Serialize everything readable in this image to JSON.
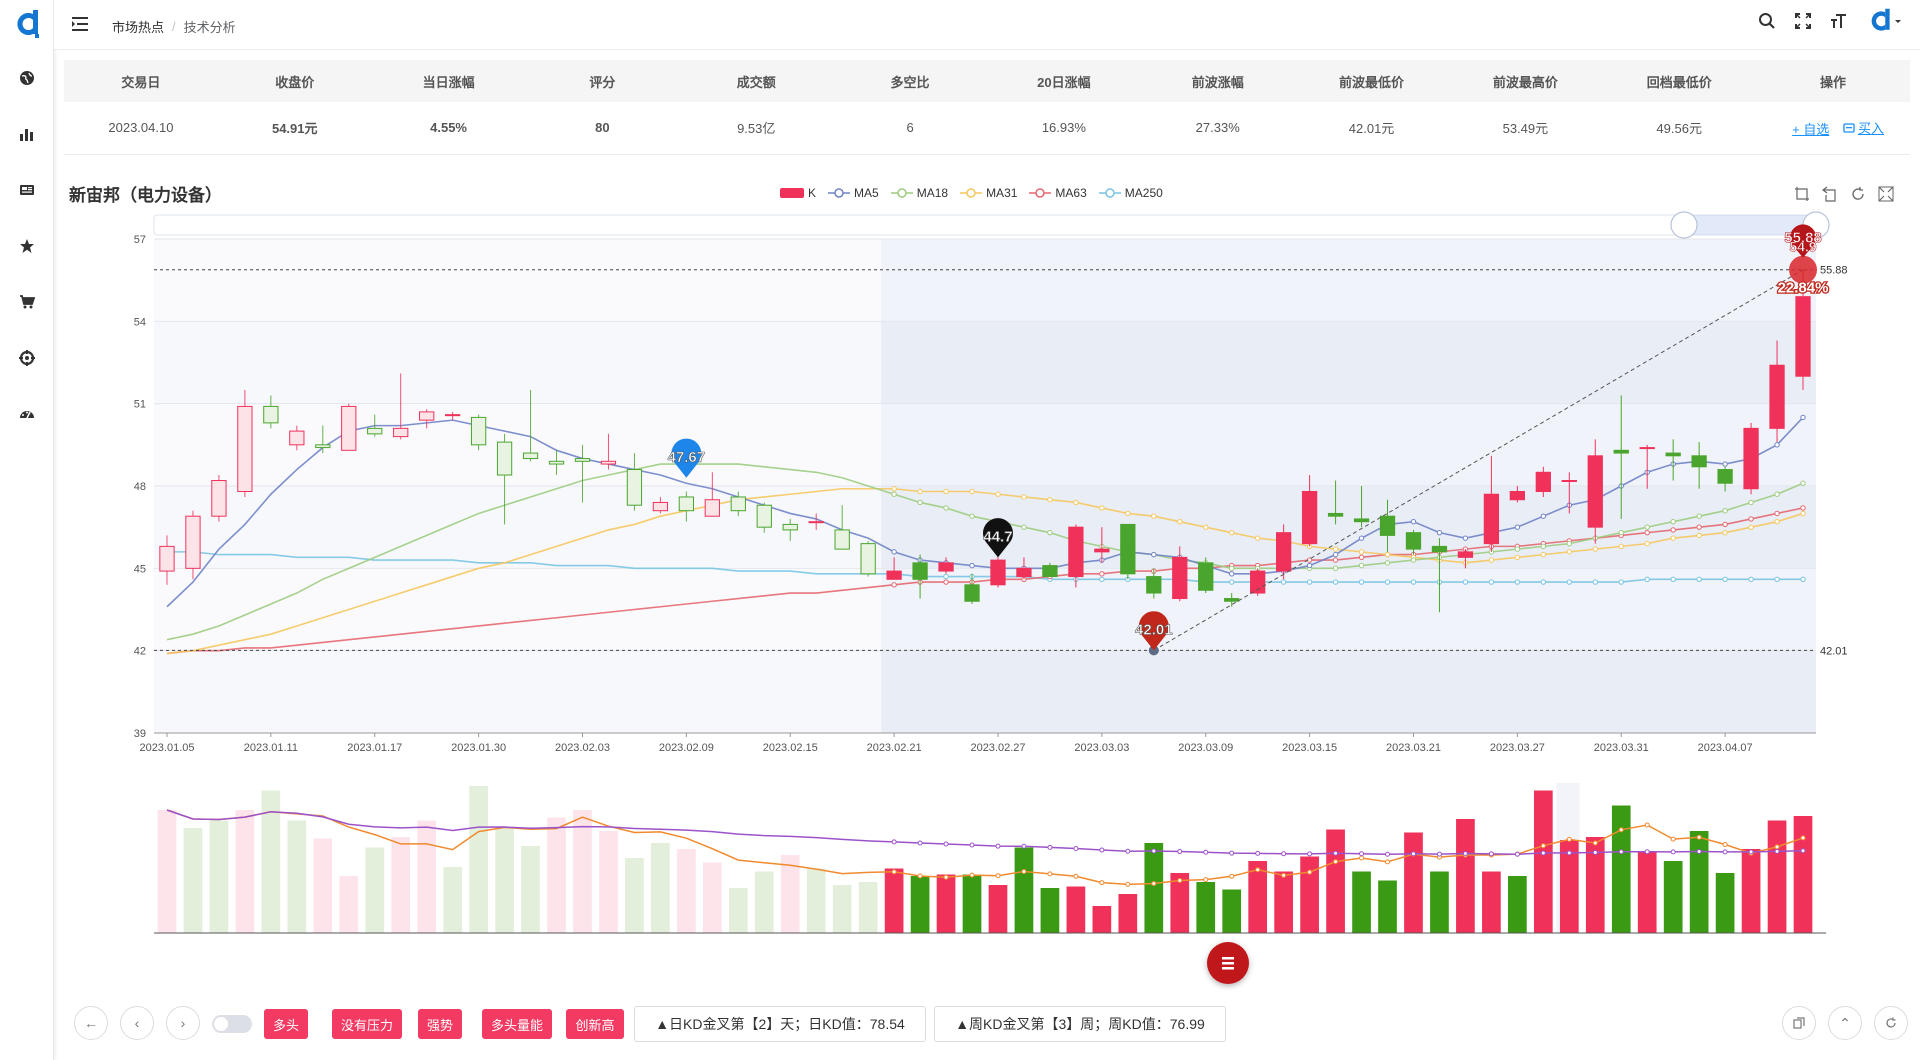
{
  "breadcrumb": {
    "parent": "市场热点",
    "current": "技术分析"
  },
  "summary": {
    "headers": [
      "交易日",
      "收盘价",
      "当日涨幅",
      "评分",
      "成交额",
      "多空比",
      "20日涨幅",
      "前波涨幅",
      "前波最低价",
      "前波最高价",
      "回档最低价",
      "操作"
    ],
    "row": {
      "trade_date": "2023.04.10",
      "close": "54.91元",
      "day_change": "4.55%",
      "score": "80",
      "turnover": "9.53亿",
      "bull_bear": "6",
      "change_20d": "16.93%",
      "prev_wave_change": "27.33%",
      "prev_wave_low": "42.01元",
      "prev_wave_high": "53.49元",
      "pullback_low": "49.56元",
      "op_watch": "+ 自选",
      "op_buy": "买入"
    }
  },
  "chart_title": "新宙邦（电力设备）",
  "legend": [
    {
      "name": "K",
      "color": "#f0325b"
    },
    {
      "name": "MA5",
      "color": "#6f83c6"
    },
    {
      "name": "MA18",
      "color": "#9ccc7f"
    },
    {
      "name": "MA31",
      "color": "#f5c75d"
    },
    {
      "name": "MA63",
      "color": "#e4676f"
    },
    {
      "name": "MA250",
      "color": "#79c4e2"
    }
  ],
  "chart_data": {
    "type": "candlestick",
    "x_ticks": [
      "2023.01.05",
      "2023.01.11",
      "2023.01.17",
      "2023.01.30",
      "2023.02.03",
      "2023.02.09",
      "2023.02.15",
      "2023.02.21",
      "2023.02.27",
      "2023.03.03",
      "2023.03.09",
      "2023.03.15",
      "2023.03.21",
      "2023.03.27",
      "2023.03.31",
      "2023.04.07"
    ],
    "y_ticks": [
      57,
      54,
      51,
      48,
      45,
      42,
      39
    ],
    "ylim": [
      39,
      57
    ],
    "ohlc": [
      [
        44.9,
        45.8,
        44.4,
        46.2
      ],
      [
        45.0,
        46.9,
        44.6,
        47.1
      ],
      [
        46.9,
        48.2,
        46.7,
        48.4
      ],
      [
        47.8,
        50.9,
        47.6,
        51.5
      ],
      [
        50.9,
        50.3,
        50.1,
        51.3
      ],
      [
        49.5,
        50.0,
        49.3,
        50.2
      ],
      [
        49.5,
        49.4,
        49.2,
        50.2
      ],
      [
        49.3,
        50.9,
        49.3,
        51.0
      ],
      [
        50.1,
        49.9,
        49.8,
        50.6
      ],
      [
        49.8,
        50.1,
        49.7,
        52.1
      ],
      [
        50.4,
        50.7,
        50.1,
        50.8
      ],
      [
        50.6,
        50.6,
        50.4,
        50.7
      ],
      [
        50.5,
        49.5,
        49.3,
        50.6
      ],
      [
        49.6,
        48.4,
        46.6,
        49.9
      ],
      [
        49.2,
        49.0,
        48.9,
        51.5
      ],
      [
        48.9,
        48.8,
        48.4,
        49.3
      ],
      [
        49.0,
        48.9,
        47.4,
        49.5
      ],
      [
        48.8,
        48.9,
        48.6,
        49.9
      ],
      [
        48.6,
        47.3,
        47.1,
        49.2
      ],
      [
        47.1,
        47.4,
        47.0,
        47.6
      ],
      [
        47.6,
        47.1,
        46.7,
        47.8
      ],
      [
        46.9,
        47.5,
        46.9,
        48.5
      ],
      [
        47.6,
        47.1,
        46.9,
        47.8
      ],
      [
        47.3,
        46.5,
        46.3,
        47.4
      ],
      [
        46.6,
        46.4,
        46.0,
        46.8
      ],
      [
        46.7,
        46.7,
        46.4,
        47.0
      ],
      [
        46.4,
        45.7,
        45.7,
        47.3
      ],
      [
        45.9,
        44.8,
        44.7,
        46.0
      ],
      [
        44.6,
        44.9,
        44.6,
        45.4
      ],
      [
        45.2,
        44.6,
        43.9,
        45.5
      ],
      [
        44.9,
        45.2,
        44.8,
        45.4
      ],
      [
        44.4,
        43.8,
        43.7,
        44.8
      ],
      [
        44.4,
        45.3,
        44.3,
        45.6
      ],
      [
        44.7,
        45.0,
        44.6,
        45.4
      ],
      [
        45.1,
        44.7,
        44.7,
        45.2
      ],
      [
        44.7,
        46.5,
        44.3,
        46.6
      ],
      [
        45.6,
        45.7,
        45.2,
        46.5
      ],
      [
        46.6,
        44.8,
        44.6,
        46.6
      ],
      [
        44.7,
        44.1,
        43.9,
        45.0
      ],
      [
        43.9,
        45.4,
        43.8,
        45.8
      ],
      [
        45.2,
        44.2,
        44.1,
        45.4
      ],
      [
        43.9,
        43.8,
        43.6,
        44.1
      ],
      [
        44.1,
        44.9,
        44.0,
        45.0
      ],
      [
        44.9,
        46.3,
        44.6,
        46.6
      ],
      [
        45.9,
        47.8,
        45.8,
        48.4
      ],
      [
        47.0,
        46.9,
        46.6,
        48.2
      ],
      [
        46.8,
        46.7,
        46.5,
        48.0
      ],
      [
        46.9,
        46.2,
        45.6,
        47.5
      ],
      [
        46.3,
        45.7,
        45.5,
        46.4
      ],
      [
        45.8,
        45.6,
        43.4,
        46.1
      ],
      [
        45.4,
        45.6,
        45.0,
        45.7
      ],
      [
        45.9,
        47.7,
        45.6,
        49.1
      ],
      [
        47.5,
        47.8,
        47.4,
        48.0
      ],
      [
        47.8,
        48.5,
        47.6,
        48.7
      ],
      [
        48.2,
        48.2,
        47.0,
        48.5
      ],
      [
        46.5,
        49.1,
        45.9,
        49.7
      ],
      [
        49.3,
        49.2,
        46.8,
        51.3
      ],
      [
        49.4,
        49.4,
        47.9,
        49.5
      ],
      [
        49.2,
        49.1,
        48.2,
        49.7
      ],
      [
        49.1,
        48.7,
        47.9,
        49.6
      ],
      [
        48.6,
        48.1,
        47.8,
        48.7
      ],
      [
        47.9,
        50.1,
        47.7,
        50.3
      ],
      [
        50.1,
        52.4,
        49.6,
        53.3
      ],
      [
        52.0,
        54.9,
        51.5,
        55.9
      ]
    ],
    "ma5": [
      43.6,
      44.5,
      45.7,
      46.6,
      47.7,
      48.6,
      49.4,
      50.0,
      50.2,
      50.2,
      50.3,
      50.4,
      50.2,
      50.0,
      49.8,
      49.3,
      49.0,
      48.8,
      48.6,
      48.4,
      48.1,
      47.9,
      47.6,
      47.3,
      47.0,
      46.8,
      46.4,
      46.1,
      45.6,
      45.3,
      45.2,
      45.1,
      45.0,
      45.0,
      45.0,
      45.2,
      45.3,
      45.6,
      45.5,
      45.4,
      45.1,
      44.8,
      44.8,
      44.9,
      45.1,
      45.5,
      46.1,
      46.6,
      46.7,
      46.3,
      46.1,
      46.3,
      46.5,
      46.9,
      47.3,
      47.5,
      48.0,
      48.5,
      48.8,
      48.9,
      48.8,
      49.0,
      49.5,
      50.5
    ],
    "ma18": [
      42.4,
      42.6,
      42.9,
      43.3,
      43.7,
      44.1,
      44.6,
      45.0,
      45.4,
      45.8,
      46.2,
      46.6,
      47.0,
      47.3,
      47.6,
      47.9,
      48.2,
      48.4,
      48.6,
      48.8,
      48.8,
      48.8,
      48.8,
      48.7,
      48.6,
      48.5,
      48.3,
      48.0,
      47.7,
      47.4,
      47.2,
      46.9,
      46.7,
      46.5,
      46.3,
      46.0,
      45.8,
      45.6,
      45.5,
      45.3,
      45.2,
      45.0,
      45.0,
      45.0,
      45.0,
      45.0,
      45.1,
      45.2,
      45.3,
      45.4,
      45.5,
      45.6,
      45.7,
      45.8,
      45.9,
      46.1,
      46.3,
      46.5,
      46.7,
      46.9,
      47.1,
      47.4,
      47.7,
      48.1
    ],
    "ma31": [
      41.9,
      42.0,
      42.2,
      42.4,
      42.6,
      42.9,
      43.2,
      43.5,
      43.8,
      44.1,
      44.4,
      44.7,
      45.0,
      45.2,
      45.5,
      45.8,
      46.1,
      46.4,
      46.6,
      46.9,
      47.1,
      47.3,
      47.5,
      47.6,
      47.7,
      47.8,
      47.9,
      47.9,
      47.9,
      47.8,
      47.8,
      47.8,
      47.7,
      47.6,
      47.5,
      47.4,
      47.2,
      47.0,
      46.9,
      46.7,
      46.5,
      46.3,
      46.1,
      46.0,
      45.8,
      45.7,
      45.6,
      45.5,
      45.4,
      45.3,
      45.2,
      45.3,
      45.4,
      45.5,
      45.6,
      45.7,
      45.8,
      45.9,
      46.1,
      46.2,
      46.3,
      46.5,
      46.7,
      47.0
    ],
    "ma63": [
      41.9,
      42.0,
      42.0,
      42.1,
      42.1,
      42.2,
      42.3,
      42.4,
      42.5,
      42.6,
      42.7,
      42.8,
      42.9,
      43.0,
      43.1,
      43.2,
      43.3,
      43.4,
      43.5,
      43.6,
      43.7,
      43.8,
      43.9,
      44.0,
      44.1,
      44.1,
      44.2,
      44.3,
      44.4,
      44.5,
      44.5,
      44.5,
      44.6,
      44.6,
      44.7,
      44.8,
      44.8,
      44.9,
      44.9,
      45.0,
      45.0,
      45.1,
      45.1,
      45.2,
      45.3,
      45.3,
      45.4,
      45.5,
      45.5,
      45.6,
      45.7,
      45.8,
      45.8,
      45.9,
      46.0,
      46.1,
      46.2,
      46.3,
      46.4,
      46.5,
      46.6,
      46.8,
      47.0,
      47.2
    ],
    "ma250": [
      45.6,
      45.6,
      45.5,
      45.5,
      45.5,
      45.4,
      45.4,
      45.4,
      45.3,
      45.3,
      45.3,
      45.3,
      45.2,
      45.2,
      45.2,
      45.1,
      45.1,
      45.1,
      45.0,
      45.0,
      45.0,
      45.0,
      44.9,
      44.9,
      44.9,
      44.8,
      44.8,
      44.8,
      44.8,
      44.7,
      44.7,
      44.7,
      44.7,
      44.7,
      44.6,
      44.6,
      44.6,
      44.6,
      44.6,
      44.6,
      44.5,
      44.5,
      44.5,
      44.5,
      44.5,
      44.5,
      44.5,
      44.5,
      44.5,
      44.5,
      44.5,
      44.5,
      44.5,
      44.5,
      44.5,
      44.5,
      44.5,
      44.6,
      44.6,
      44.6,
      44.6,
      44.6,
      44.6,
      44.6
    ],
    "volume": [
      82,
      70,
      75,
      82,
      95,
      75,
      63,
      38,
      57,
      64,
      75,
      44,
      98,
      71,
      58,
      77,
      82,
      68,
      50,
      60,
      56,
      47,
      30,
      41,
      52,
      43,
      32,
      34,
      43,
      38,
      39,
      39,
      32,
      57,
      30,
      31,
      18,
      26,
      60,
      40,
      34,
      29,
      48,
      41,
      51,
      69,
      41,
      35,
      67,
      41,
      76,
      41,
      38,
      95,
      62,
      64,
      85,
      54,
      48,
      68,
      40,
      56,
      75,
      78
    ],
    "volume_up": [
      true,
      false,
      false,
      true,
      false,
      false,
      true,
      true,
      false,
      true,
      true,
      false,
      false,
      false,
      false,
      true,
      true,
      true,
      false,
      false,
      true,
      true,
      false,
      false,
      true,
      false,
      false,
      false,
      true,
      false,
      true,
      false,
      true,
      false,
      false,
      true,
      true,
      true,
      false,
      true,
      false,
      false,
      true,
      true,
      true,
      true,
      false,
      false,
      true,
      false,
      true,
      true,
      false,
      true,
      true,
      true,
      false,
      true,
      false,
      false,
      false,
      true,
      true,
      true
    ],
    "annotations": {
      "high_label": "55.88",
      "high_label_overlap": "54.9",
      "pct_label": "22.84%",
      "high_line_value": "55.88",
      "low_line_value": "42.01",
      "pin_low": "42.01",
      "pin_blue": "47.67",
      "pin_dark": "44.7"
    }
  },
  "bottom": {
    "tags": [
      "多头",
      "没有压力",
      "强势",
      "多头量能",
      "创新高"
    ],
    "kd_day": "▲日KD金叉第【2】天；日KD值：78.54",
    "kd_week": "▲周KD金叉第【3】周；周KD值：76.99"
  }
}
